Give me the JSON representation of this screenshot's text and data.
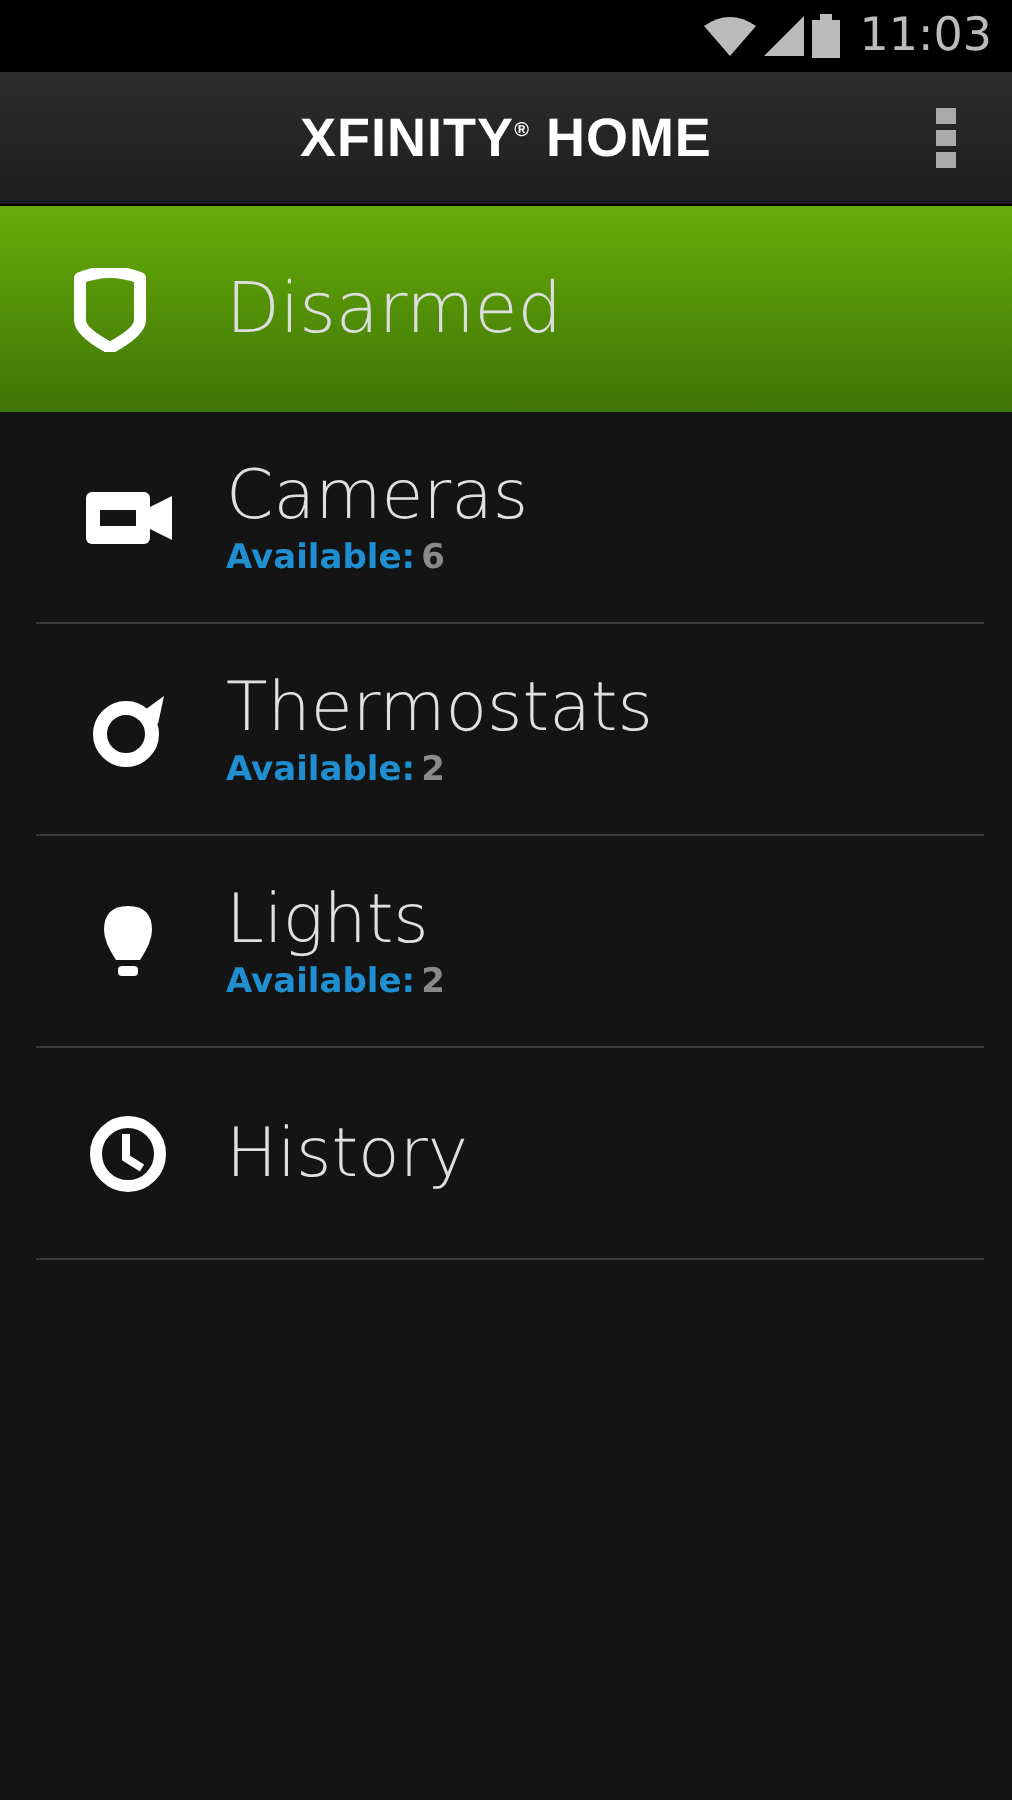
{
  "status_bar": {
    "time": "11:03"
  },
  "app_bar": {
    "title": "XFINITY$^{®}$ HOME"
  },
  "security": {
    "kind": "shield",
    "label": "Disarmed"
  },
  "items": [
    {
      "kind": "camera",
      "label": "Cameras",
      "available_label": "Available:",
      "count": "6"
    },
    {
      "kind": "thermostat",
      "label": "Thermostats",
      "available_label": "Available:",
      "count": "2"
    },
    {
      "kind": "light",
      "label": "Lights",
      "available_label": "Available:",
      "count": "2"
    },
    {
      "kind": "history",
      "label": "History"
    }
  ]
}
